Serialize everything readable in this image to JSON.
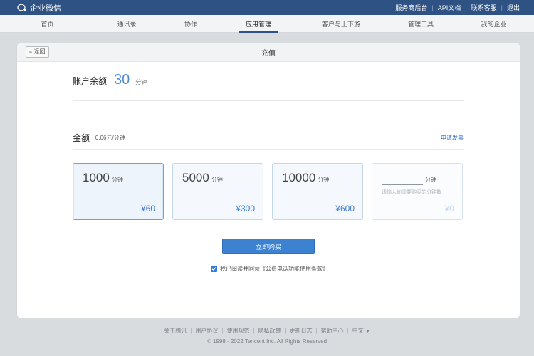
{
  "topbar": {
    "brand": "企业微信",
    "links": [
      "服务商后台",
      "API文档",
      "联系客服",
      "退出"
    ]
  },
  "nav": {
    "items": [
      "首页",
      "通讯录",
      "协作",
      "应用管理",
      "客户与上下游",
      "管理工具",
      "我的企业"
    ],
    "active_index": 3
  },
  "page": {
    "back": "« 返回",
    "title": "充值"
  },
  "balance": {
    "label": "账户余额",
    "value": "30",
    "unit": "分钟"
  },
  "amount": {
    "label": "金额",
    "rate": "· 0.06元/分钟",
    "invoice": "申请发票"
  },
  "options": [
    {
      "minutes": "1000",
      "unit": "分钟",
      "price": "¥60"
    },
    {
      "minutes": "5000",
      "unit": "分钟",
      "price": "¥300"
    },
    {
      "minutes": "10000",
      "unit": "分钟",
      "price": "¥600"
    }
  ],
  "custom_option": {
    "unit": "分钟",
    "placeholder": "请输入你需要购买的分钟数",
    "price": "¥0"
  },
  "buy_button": "立即购买",
  "agreement": "我已阅读并同意《公费电话功能使用条款》",
  "footer": {
    "links": [
      "关于腾讯",
      "用户协议",
      "使用规范",
      "隐私政策",
      "更新日志",
      "帮助中心",
      "中文"
    ],
    "copyright": "© 1998 - 2022 Tencent Inc. All Rights Reserved"
  },
  "colors": {
    "topbar": "#2e5283",
    "accent": "#3d82d0",
    "price": "#3a7bd5"
  }
}
